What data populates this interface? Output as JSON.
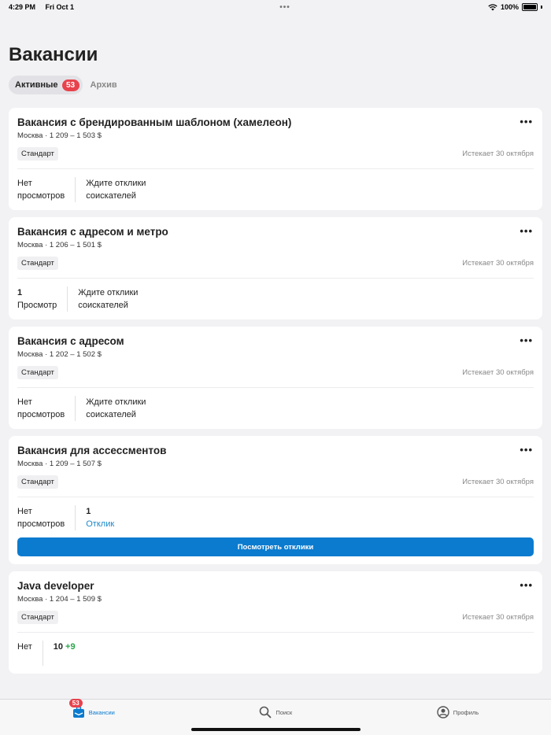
{
  "status": {
    "time": "4:29 PM",
    "date": "Fri Oct 1",
    "battery": "100%"
  },
  "page": {
    "title": "Вакансии"
  },
  "tabs": [
    {
      "label": "Активные",
      "badge": "53"
    },
    {
      "label": "Архив"
    }
  ],
  "cards": [
    {
      "title": "Вакансия с брендированным шаблоном (хамелеон)",
      "sub": "Москва · 1 209 – 1 503 $",
      "tag": "Стандарт",
      "expires": "Истекает 30 октября",
      "left_line1": "Нет",
      "left_line2": "просмотров",
      "right_line1": "Ждите отклики",
      "right_line2": "соискателей"
    },
    {
      "title": "Вакансия с адресом и метро",
      "sub": "Москва · 1 206 – 1 501 $",
      "tag": "Стандарт",
      "expires": "Истекает 30 октября",
      "left_line1": "1",
      "left_line2": "Просмотр",
      "right_line1": "Ждите отклики",
      "right_line2": "соискателей"
    },
    {
      "title": "Вакансия с адресом",
      "sub": "Москва · 1 202 – 1 502 $",
      "tag": "Стандарт",
      "expires": "Истекает 30 октября",
      "left_line1": "Нет",
      "left_line2": "просмотров",
      "right_line1": "Ждите отклики",
      "right_line2": "соискателей"
    },
    {
      "title": "Вакансия для ассессментов",
      "sub": "Москва · 1 209 – 1 507 $",
      "tag": "Стандарт",
      "expires": "Истекает 30 октября",
      "left_line1": "Нет",
      "left_line2": "просмотров",
      "right_line1": "1",
      "right_line2": "Отклик",
      "button": "Посмотреть отклики"
    },
    {
      "title": "Java developer",
      "sub": "Москва · 1 204 – 1 509 $",
      "tag": "Стандарт",
      "expires": "Истекает 30 октября",
      "left_line1": "Нет",
      "right_line1": "10",
      "right_delta": "+9"
    }
  ],
  "tabbar": [
    {
      "label": "Вакансии",
      "badge": "53",
      "icon": "briefcase-icon"
    },
    {
      "label": "Поиск",
      "icon": "search-icon"
    },
    {
      "label": "Профиль",
      "icon": "profile-icon"
    }
  ],
  "colors": {
    "accent": "#0b7bcf",
    "badge": "#e8424c",
    "link": "#1a88c9",
    "positive": "#2aa74a"
  }
}
